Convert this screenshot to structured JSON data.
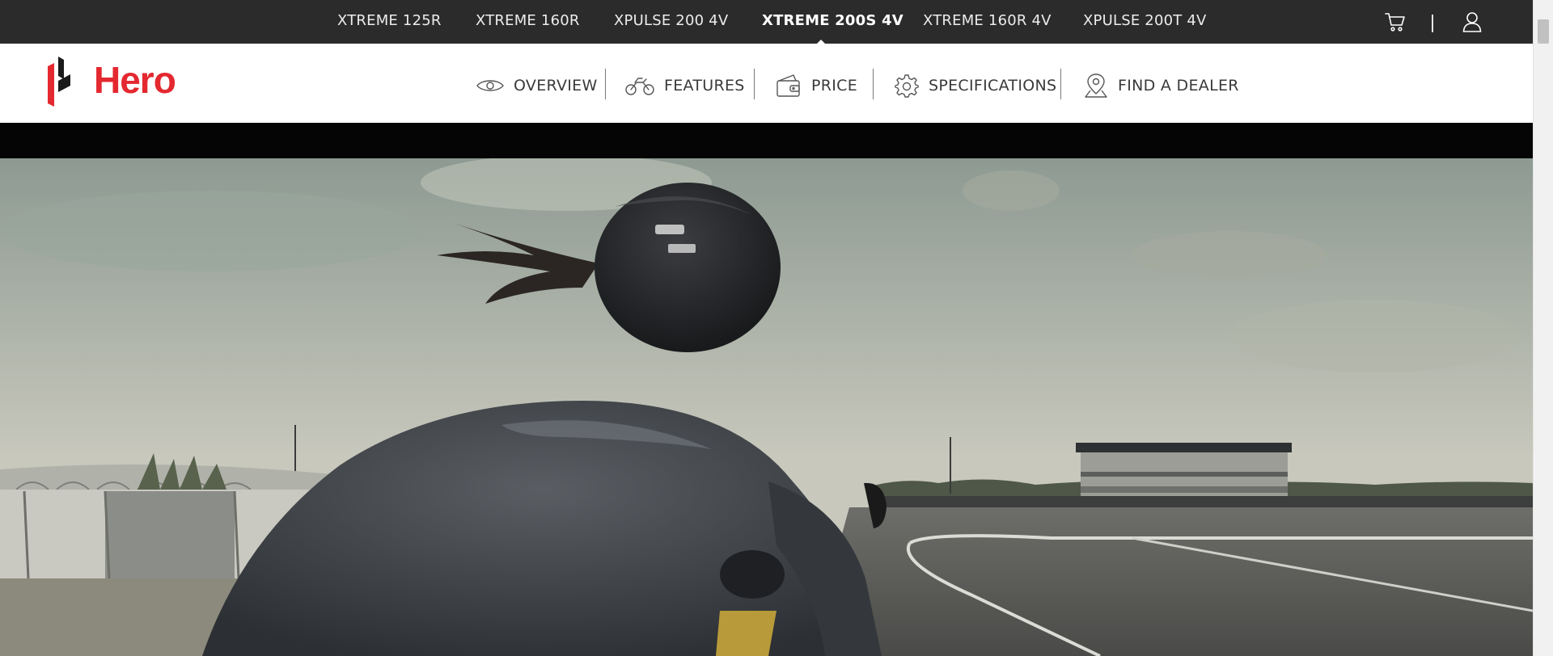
{
  "models": {
    "items": [
      {
        "label": "XTREME 125R",
        "active": false
      },
      {
        "label": "XTREME 160R",
        "active": false
      },
      {
        "label": "XPULSE 200 4V",
        "active": false
      },
      {
        "label": "XTREME 200S 4V",
        "active": true
      },
      {
        "label": "XTREME 160R 4V",
        "active": false
      },
      {
        "label": "XPULSE 200T 4V",
        "active": false
      }
    ],
    "cart_icon": "cart-icon",
    "user_icon": "user-icon"
  },
  "header": {
    "logo_text": "Hero",
    "nav": [
      {
        "label": "OVERVIEW",
        "icon": "eye-icon"
      },
      {
        "label": "FEATURES",
        "icon": "motorcycle-icon"
      },
      {
        "label": "PRICE",
        "icon": "wallet-icon"
      },
      {
        "label": "SPECIFICATIONS",
        "icon": "gear-icon"
      },
      {
        "label": "FIND A DEALER",
        "icon": "location-pin-icon"
      }
    ]
  },
  "colors": {
    "brand_red": "#e4282f",
    "model_bar": "#2b2b2b",
    "black_strip": "#050505"
  }
}
